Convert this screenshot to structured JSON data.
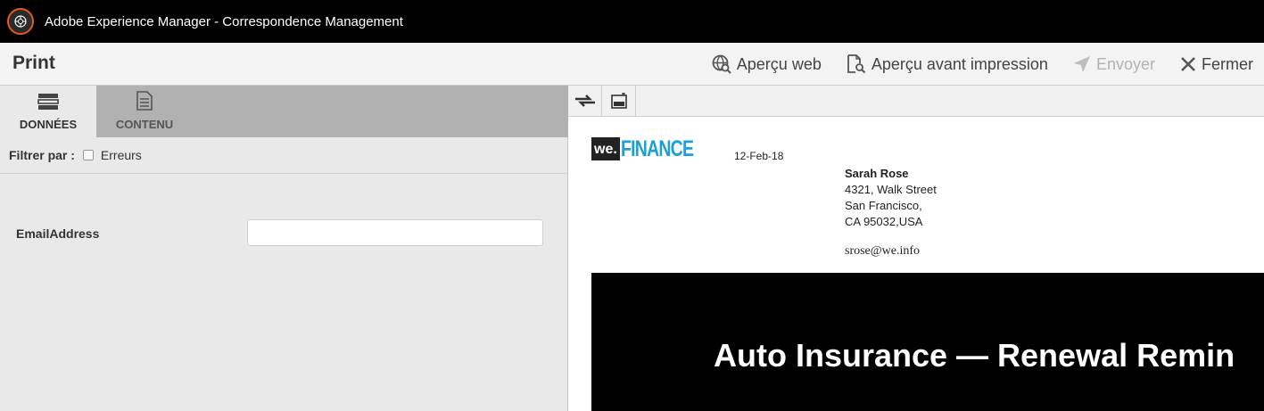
{
  "app": {
    "title": "Adobe Experience Manager - Correspondence Management",
    "accent_color": "#e8571e"
  },
  "header": {
    "page_title": "Print",
    "actions": [
      {
        "label": "Aperçu web",
        "icon": "globe-search-icon",
        "enabled": true
      },
      {
        "label": "Aperçu avant impression",
        "icon": "document-search-icon",
        "enabled": true
      },
      {
        "label": "Envoyer",
        "icon": "send-icon",
        "enabled": false
      },
      {
        "label": "Fermer",
        "icon": "close-icon",
        "enabled": true
      }
    ]
  },
  "left": {
    "tabs": [
      {
        "label": "DONNÉES",
        "icon": "data-icon",
        "active": true
      },
      {
        "label": "CONTENU",
        "icon": "content-icon",
        "active": false
      }
    ],
    "filter": {
      "label": "Filtrer par :",
      "option": "Erreurs",
      "checked": false
    },
    "fields": [
      {
        "label": "EmailAddress",
        "value": ""
      }
    ]
  },
  "preview": {
    "toolbar": [
      {
        "icon": "expand-horizontal-icon"
      },
      {
        "icon": "panel-toggle-icon"
      }
    ],
    "letter": {
      "brand_prefix": "we.",
      "brand_name": "FINANCE",
      "brand_color": "#1a9fd8",
      "date": "12-Feb-18",
      "recipient_name": "Sarah Rose",
      "address_line1": "4321, Walk Street",
      "address_line2": "San Francisco,",
      "address_line3": "CA 95032,USA",
      "email": "srose@we.info",
      "banner_title": "Auto Insurance — Renewal Remin"
    }
  }
}
